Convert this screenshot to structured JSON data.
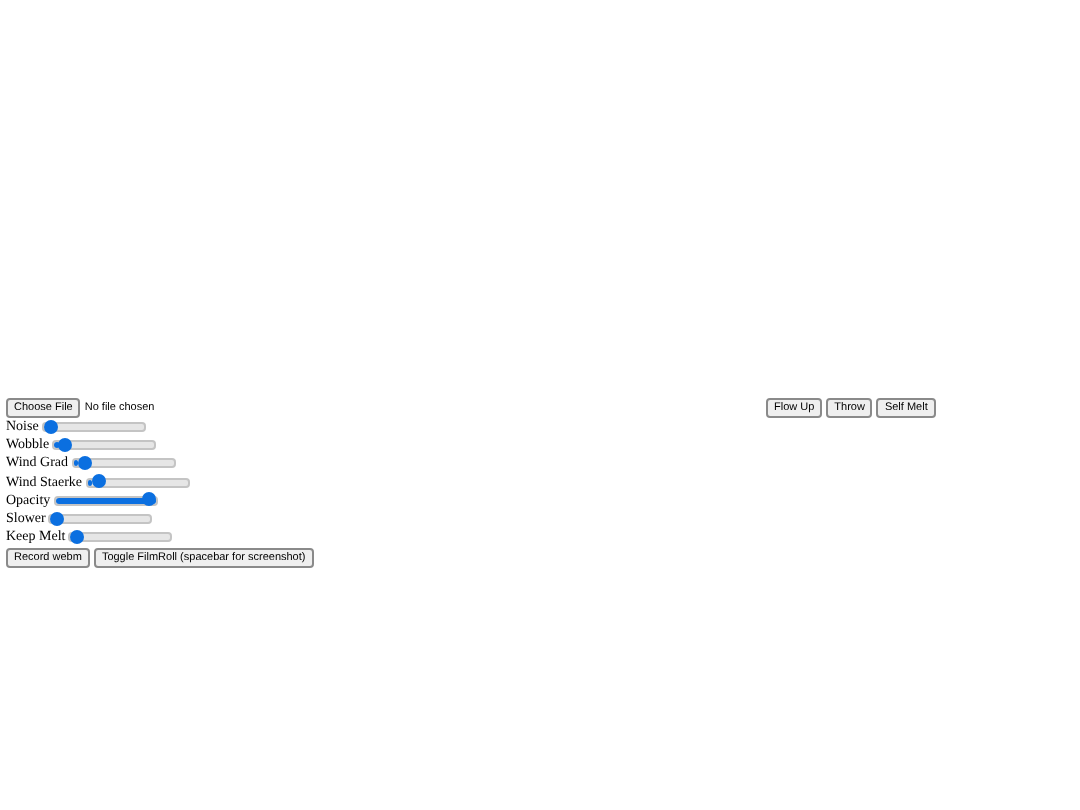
{
  "file_input": {
    "button": "Choose File",
    "status": "No file chosen"
  },
  "actions": [
    "Flow Up",
    "Throw",
    "Self Melt"
  ],
  "sliders": [
    {
      "label": "Noise",
      "level": 0.0
    },
    {
      "label": "Wobble",
      "level": 0.05
    },
    {
      "label": "Wind Grad",
      "level": 0.05
    },
    {
      "label": "Wind Staerke",
      "level": 0.05
    },
    {
      "label": "Opacity",
      "level": 1.0
    },
    {
      "label": "Slower",
      "level": 0.0
    },
    {
      "label": "Keep Melt",
      "level": 0.0
    }
  ],
  "buttons": [
    "Record webm",
    "Toggle FilmRoll (spacebar for screenshot)"
  ]
}
